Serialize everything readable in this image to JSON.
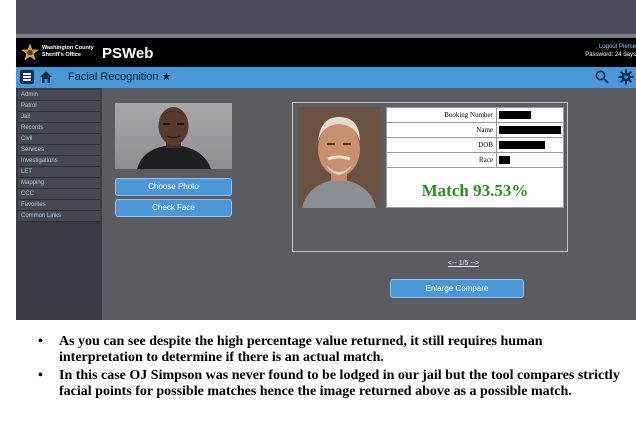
{
  "header": {
    "agency_line1": "Washington County",
    "agency_line2": "Sheriff's Office",
    "brand": "PSWeb",
    "logout": "Logout Pierce",
    "password_notice": "Password: 24 days"
  },
  "navbar": {
    "title": "Facial Recognition ★",
    "icons": [
      "menu-icon",
      "home-icon",
      "search-icon",
      "gear-icon"
    ]
  },
  "sidebar": {
    "items": [
      {
        "label": "Admin"
      },
      {
        "label": "Patrol"
      },
      {
        "label": "Jail"
      },
      {
        "label": "Records"
      },
      {
        "label": "Civil"
      },
      {
        "label": "Services"
      },
      {
        "label": "Investigations"
      },
      {
        "label": "LET"
      },
      {
        "label": "Mapping"
      },
      {
        "label": "CCC"
      },
      {
        "label": "Favorites"
      },
      {
        "label": "Common Links"
      }
    ]
  },
  "search": {
    "choose_photo_label": "Choose Photo",
    "check_face_label": "Check Face"
  },
  "result": {
    "fields": [
      {
        "label": "Booking Number",
        "value": "[redacted]"
      },
      {
        "label": "Name",
        "value": "[redacted]"
      },
      {
        "label": "DOB",
        "value": "[redacted]"
      },
      {
        "label": "Race",
        "value": "[redacted]"
      }
    ],
    "match_text": "Match 93.53%",
    "match_percent": 93.53,
    "match_color": "#2e8b25",
    "pager": "<-- 1/5 -->",
    "enlarge_label": "Enlarge Compare"
  },
  "colors": {
    "accent": "#4898d8",
    "header_bg": "#000000",
    "content_bg": "#5b5c62"
  },
  "notes": [
    "As you can see despite the high percentage value returned, it still requires human interpretation to determine if there is an actual match.",
    "In this case OJ Simpson was never found to be lodged in our jail but the tool compares strictly facial points for possible matches hence the image returned above as a possible match."
  ]
}
